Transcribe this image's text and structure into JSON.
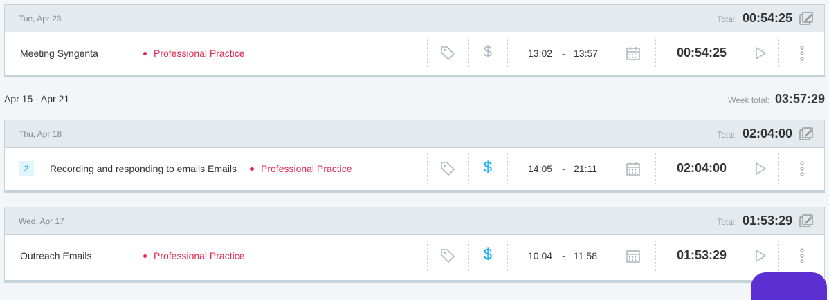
{
  "days": [
    {
      "label": "Tue, Apr 23",
      "total_label": "Total:",
      "total": "00:54:25",
      "entry": {
        "count": null,
        "description": "Meeting Syngenta",
        "project": "Professional Practice",
        "billable": false,
        "start": "13:02",
        "separator": "-",
        "end": "13:57",
        "duration": "00:54:25"
      }
    },
    {
      "label": "Thu, Apr 18",
      "total_label": "Total:",
      "total": "02:04:00",
      "entry": {
        "count": "2",
        "description": "Recording and responding to emails Emails",
        "project": "Professional Practice",
        "billable": true,
        "start": "14:05",
        "separator": "-",
        "end": "21:11",
        "duration": "02:04:00"
      }
    },
    {
      "label": "Wed, Apr 17",
      "total_label": "Total:",
      "total": "01:53:29",
      "entry": {
        "count": null,
        "description": "Outreach Emails",
        "project": "Professional Practice",
        "billable": true,
        "start": "10:04",
        "separator": "-",
        "end": "11:58",
        "duration": "01:53:29"
      }
    }
  ],
  "week": {
    "range": "Apr 15 - Apr 21",
    "total_label": "Week total:",
    "total": "03:57:29"
  },
  "icons": {
    "tag": "tag-icon",
    "billable": "dollar-icon",
    "calendar": "calendar-icon",
    "play": "play-icon",
    "more": "more-vertical-icon",
    "bulk_edit": "bulk-edit-icon"
  },
  "colors": {
    "project": "#e0284f",
    "billable_active": "#03a9f4",
    "billable_inactive": "#b0b8bd",
    "header_bg": "#e4eaee",
    "fab": "#5b2fd1"
  }
}
